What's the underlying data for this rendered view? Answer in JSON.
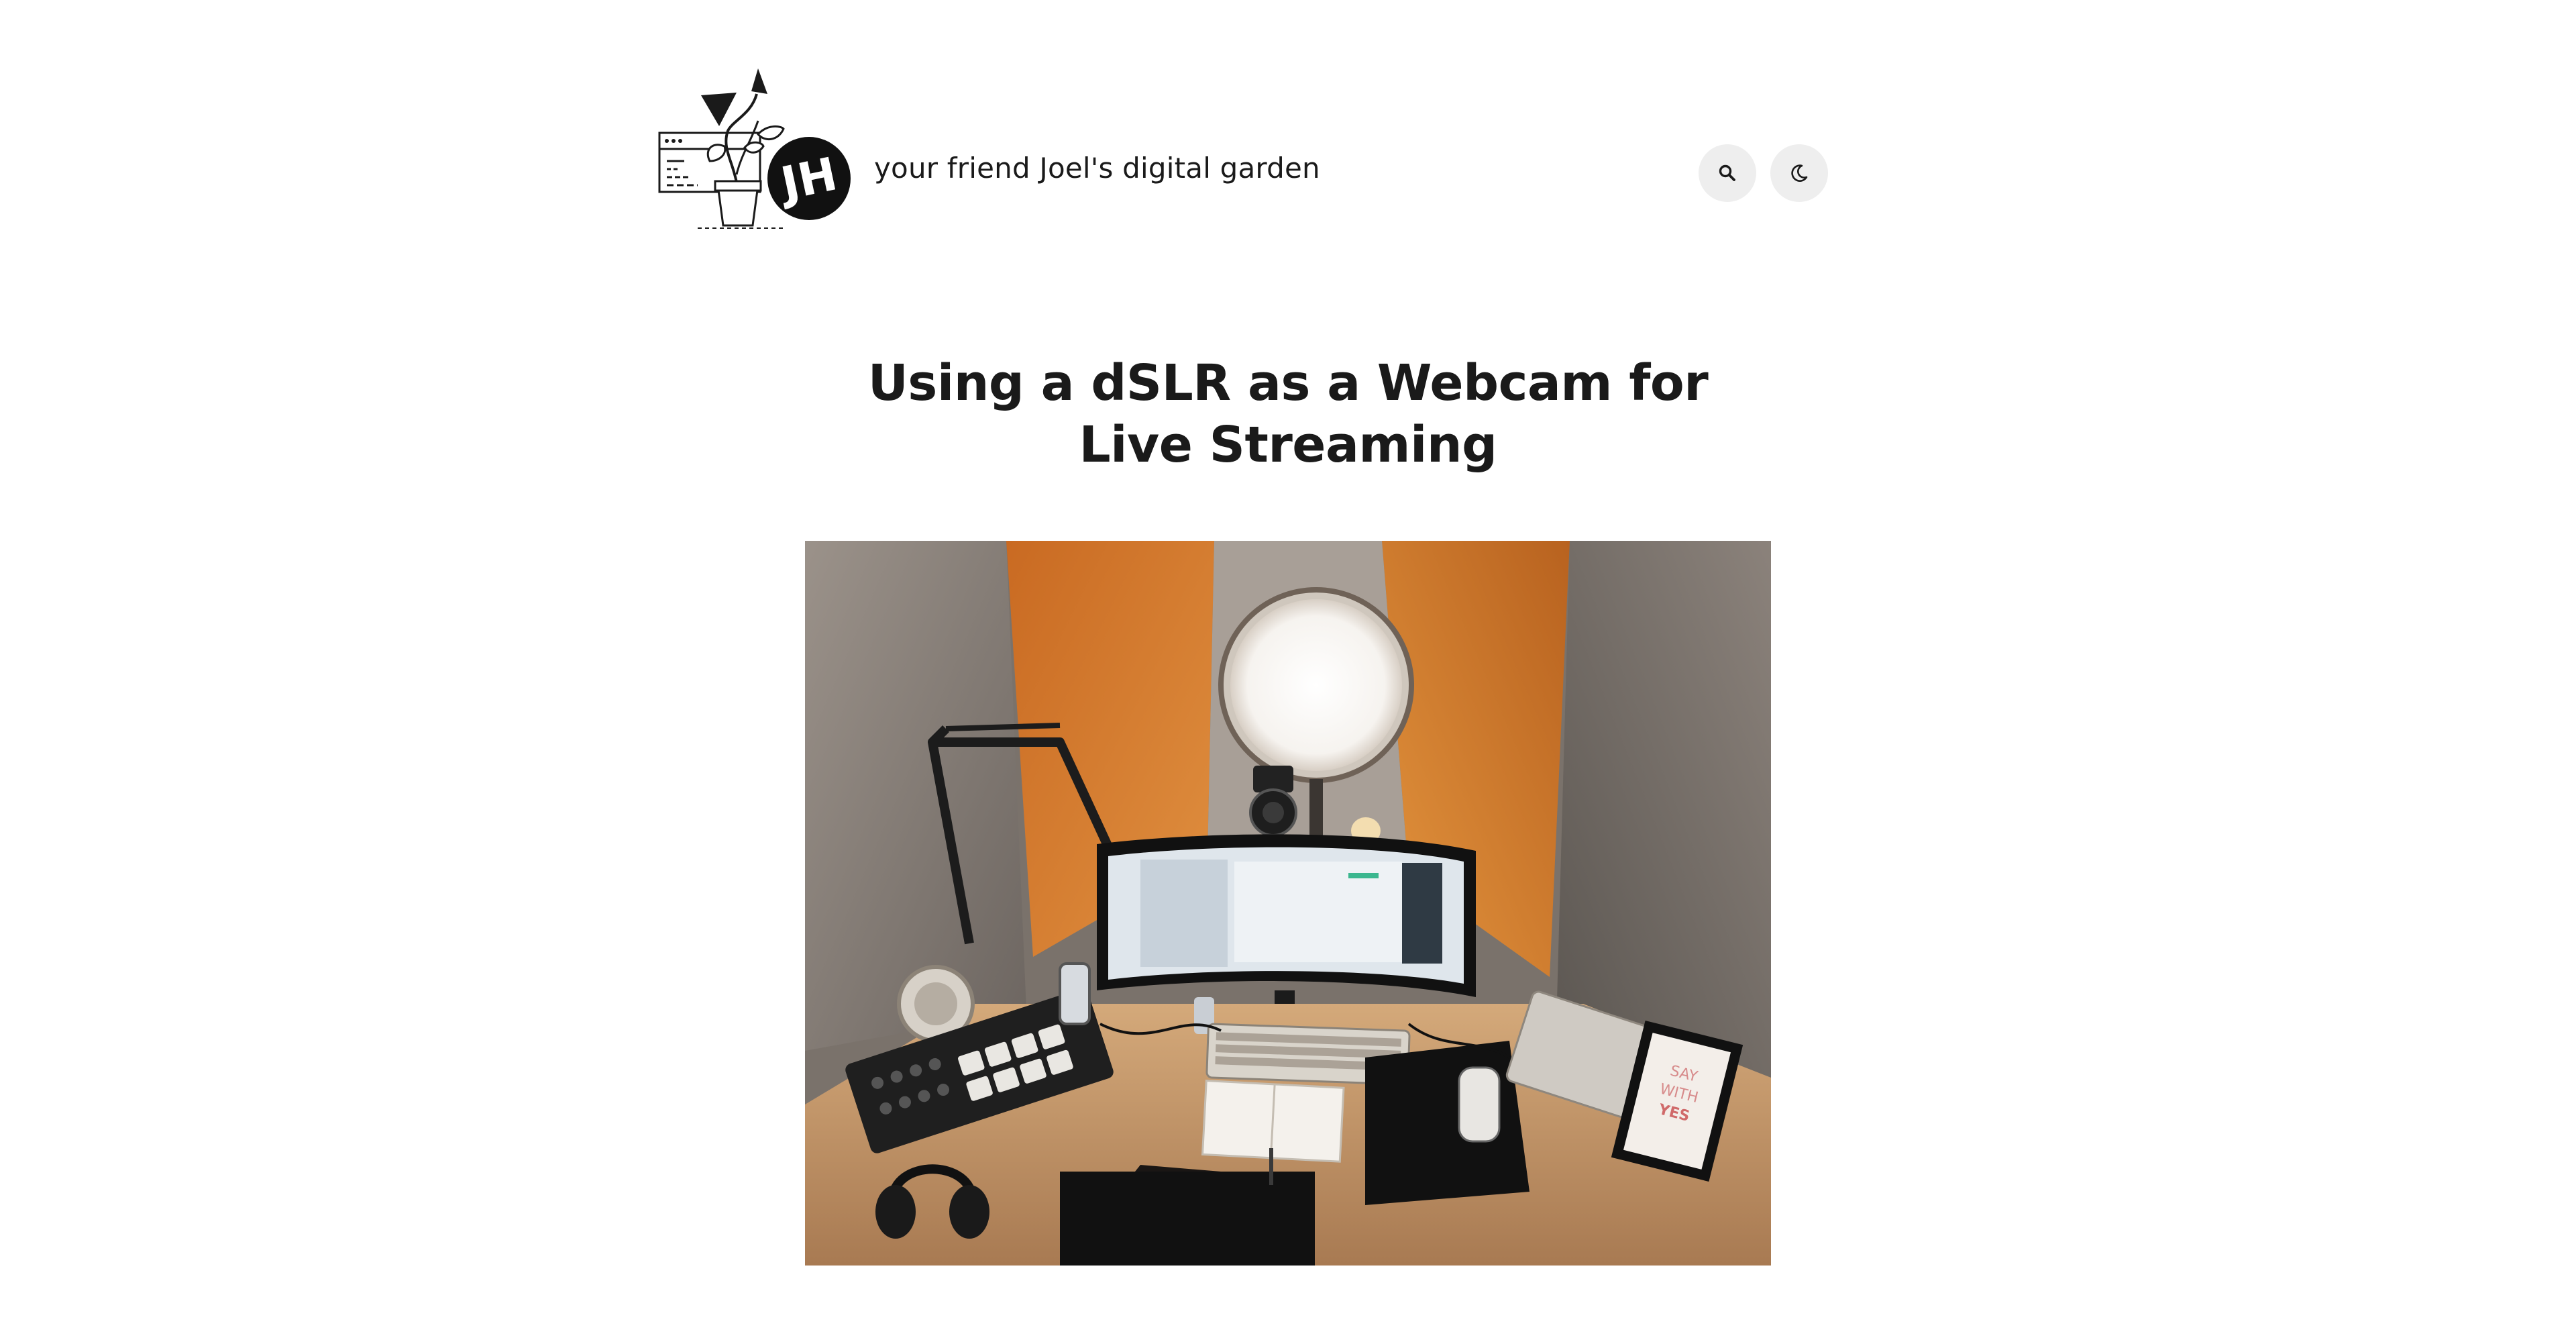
{
  "header": {
    "tagline": "your friend Joel's digital garden",
    "logo_initials": "JH",
    "search_icon": "search-icon",
    "theme_icon": "moon-icon"
  },
  "post": {
    "title": "Using a dSLR as a Webcam for Live Streaming"
  },
  "hero": {
    "sign_text": [
      "SAY",
      "WITH",
      "YES"
    ]
  },
  "colors": {
    "text": "#1a1a1a",
    "button_bg": "#eeeeee",
    "accent_orange": "#d9782a",
    "desk": "#c69a6e"
  }
}
